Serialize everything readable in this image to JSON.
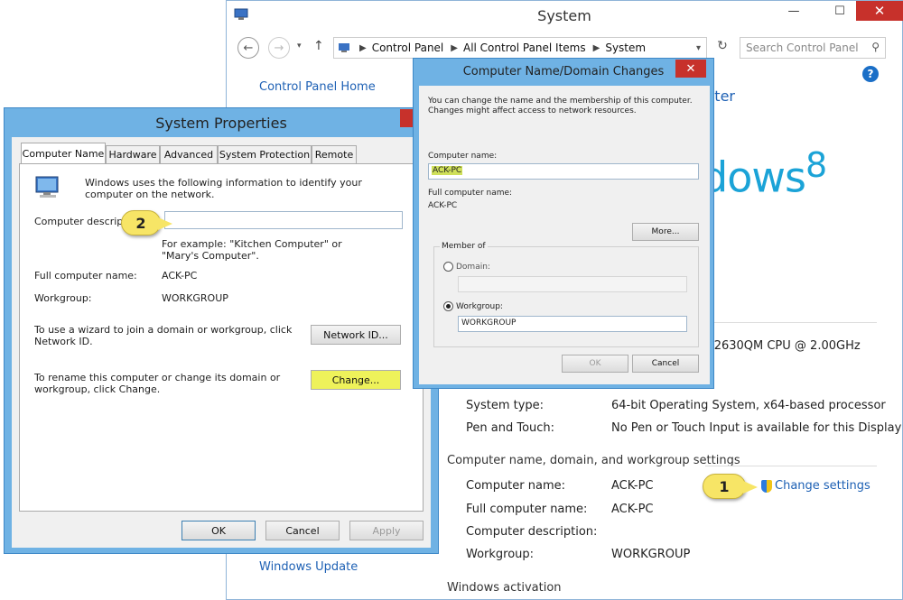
{
  "system_window": {
    "title": "System",
    "controls": {
      "minimize": "—",
      "maximize": "☐",
      "close": "✕"
    },
    "nav": {
      "back": "←",
      "forward": "→",
      "up": "↑",
      "breadcrumbs": [
        "Control Panel",
        "All Control Panel Items",
        "System"
      ],
      "search_placeholder": "Search Control Panel"
    },
    "help": "?",
    "control_panel_home": "Control Panel Home",
    "windows_update": "Windows Update",
    "computer_heading_fragment": "puter",
    "windows_logo": {
      "word": "dows",
      "number": "8"
    },
    "cpu_fragment": "-2630QM CPU @ 2.00GHz",
    "rows_top": [
      {
        "label": "System type:",
        "value": "64-bit Operating System, x64-based processor"
      },
      {
        "label": "Pen and Touch:",
        "value": "No Pen or Touch Input is available for this Display"
      }
    ],
    "section_name": "Computer name, domain, and workgroup settings",
    "rows_name": [
      {
        "label": "Computer name:",
        "value": "ACK-PC"
      },
      {
        "label": "Full computer name:",
        "value": "ACK-PC"
      },
      {
        "label": "Computer description:",
        "value": ""
      },
      {
        "label": "Workgroup:",
        "value": "WORKGROUP"
      }
    ],
    "change_settings": "Change settings",
    "section_activation": "Windows activation"
  },
  "callouts": {
    "one": "1",
    "two": "2"
  },
  "system_properties": {
    "title": "System Properties",
    "close": "✕",
    "tabs": [
      "Computer Name",
      "Hardware",
      "Advanced",
      "System Protection",
      "Remote"
    ],
    "intro": "Windows uses the following information to identify your computer on the network.",
    "description_label": "Computer description:",
    "description_value": "",
    "example": "For example: \"Kitchen Computer\" or \"Mary's Computer\".",
    "full_name_label": "Full computer name:",
    "full_name_value": "ACK-PC",
    "workgroup_label": "Workgroup:",
    "workgroup_value": "WORKGROUP",
    "wizard_text": "To use a wizard to join a domain or workgroup, click Network ID.",
    "network_id_button": "Network ID...",
    "rename_text": "To rename this computer or change its domain or workgroup, click Change.",
    "change_button": "Change...",
    "ok": "OK",
    "cancel": "Cancel",
    "apply": "Apply"
  },
  "name_domain_dialog": {
    "title": "Computer Name/Domain Changes",
    "close": "✕",
    "intro": "You can change the name and the membership of this computer. Changes might affect access to network resources.",
    "computer_name_label": "Computer name:",
    "computer_name_value": "ACK-PC",
    "full_name_label": "Full computer name:",
    "full_name_value": "ACK-PC",
    "more_button": "More...",
    "member_of": "Member of",
    "domain_label": "Domain:",
    "domain_value": "",
    "workgroup_label": "Workgroup:",
    "workgroup_value": "WORKGROUP",
    "ok": "OK",
    "cancel": "Cancel"
  }
}
